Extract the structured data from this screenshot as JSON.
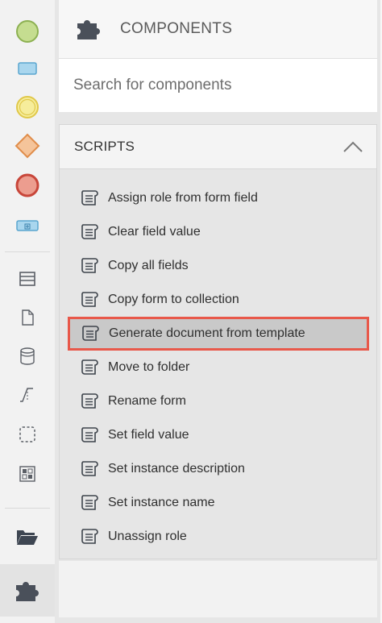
{
  "toolbar": {
    "tools": [
      {
        "name": "start-event-tool",
        "icon": "green-circle",
        "color": "#c5dd90"
      },
      {
        "name": "task-tool",
        "icon": "blue-rectangle",
        "color": "#a9d6ee"
      },
      {
        "name": "intermediate-event-tool",
        "icon": "yellow-circle",
        "color": "#f6ed9b"
      },
      {
        "name": "gateway-tool",
        "icon": "orange-diamond",
        "color": "#f5c49a"
      },
      {
        "name": "end-event-tool",
        "icon": "red-circle",
        "color": "#ec9d8f"
      },
      {
        "name": "subprocess-tool",
        "icon": "blue-subprocess",
        "color": "#a9d6ee"
      },
      {
        "name": "pool-tool",
        "icon": "pool-icon"
      },
      {
        "name": "data-object-tool",
        "icon": "document-icon"
      },
      {
        "name": "data-store-tool",
        "icon": "database-icon"
      },
      {
        "name": "annotation-tool",
        "icon": "annotation-icon"
      },
      {
        "name": "group-tool",
        "icon": "dashed-square-icon"
      },
      {
        "name": "image-tool",
        "icon": "image-icon"
      },
      {
        "name": "folder-tool",
        "icon": "folder-open-icon"
      }
    ],
    "bottom_icon": "puzzle-icon"
  },
  "components": {
    "title": "COMPONENTS",
    "icon": "puzzle-icon"
  },
  "search": {
    "placeholder": "Search for components",
    "value": ""
  },
  "scripts": {
    "title": "SCRIPTS",
    "expanded": true,
    "toggle_icon": "chevron-up-icon",
    "item_icon": "script-scroll-icon",
    "items": [
      {
        "label": "Assign role from form field"
      },
      {
        "label": "Clear field value"
      },
      {
        "label": "Copy all fields"
      },
      {
        "label": "Copy form to collection"
      },
      {
        "label": "Generate document from template",
        "highlighted": true
      },
      {
        "label": "Move to folder"
      },
      {
        "label": "Rename form"
      },
      {
        "label": "Set field value"
      },
      {
        "label": "Set instance description"
      },
      {
        "label": "Set instance name"
      },
      {
        "label": "Unassign role"
      }
    ]
  },
  "colors": {
    "highlight_border": "#e8584a",
    "highlight_fill": "#c9c9c9",
    "icon_gray": "#5b5f66"
  }
}
